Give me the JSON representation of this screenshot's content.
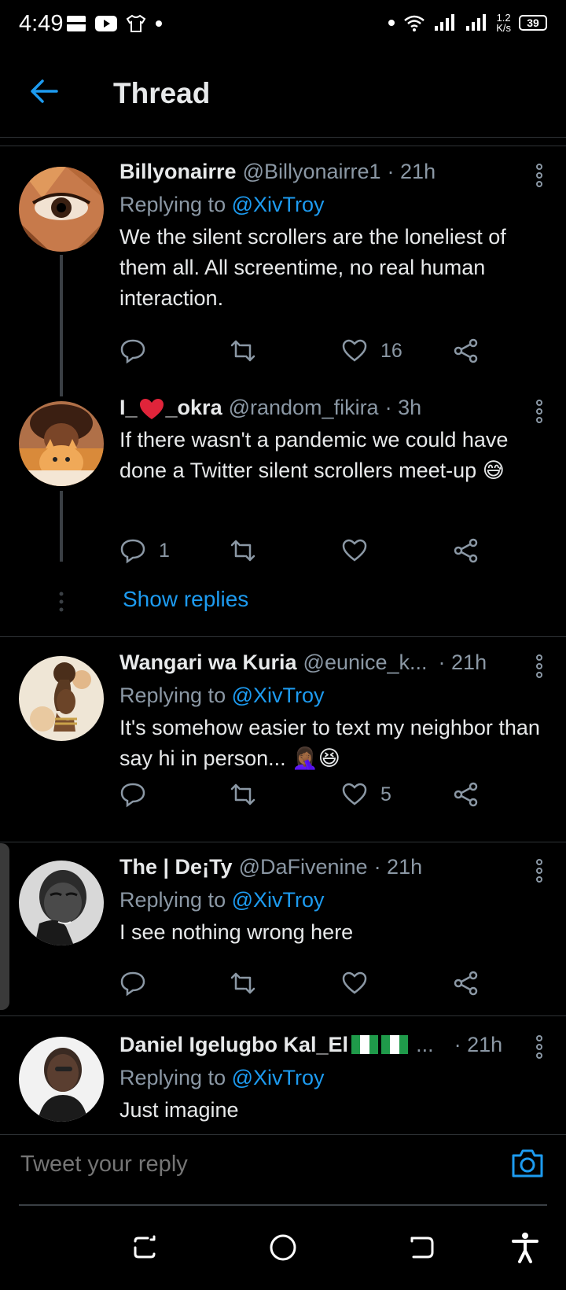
{
  "status_bar": {
    "time": "4:49",
    "net_speed_value": "1.2",
    "net_speed_unit": "K/s",
    "battery": "39"
  },
  "header": {
    "title": "Thread",
    "back_icon": "back-arrow-icon"
  },
  "tweets": [
    {
      "name": "Billyonairre",
      "handle": "@Billyonairre1",
      "time": "· 21h",
      "replying_label": "Replying to",
      "replying_to": "@XivTroy",
      "text": "We the silent scrollers are the loneliest of them all. All screentime, no real human interaction.",
      "replies": "",
      "retweets": "",
      "likes": "16"
    },
    {
      "name_prefix": "I_",
      "name_suffix": "_okra",
      "handle": "@random_fikira",
      "time": "· 3h",
      "text": "If there wasn't a pandemic we could have done a Twitter silent scrollers meet-up 😅",
      "replies": "1",
      "retweets": "",
      "likes": ""
    },
    {
      "name": "Wangari wa Kuria",
      "handle": "@eunice_k...",
      "time": "· 21h",
      "replying_label": "Replying to",
      "replying_to": "@XivTroy",
      "text": "It's somehow easier to text my neighbor than say hi in person... 🤦🏾‍♀️😆",
      "replies": "",
      "retweets": "",
      "likes": "5"
    },
    {
      "name": "The | De¡Ty",
      "handle": "@DaFivenine",
      "time": "· 21h",
      "replying_label": "Replying to",
      "replying_to": "@XivTroy",
      "text": "I see nothing wrong here",
      "replies": "",
      "retweets": "",
      "likes": ""
    },
    {
      "name": "Daniel Igelugbo Kal_El",
      "handle": "...",
      "time": "· 21h",
      "replying_label": "Replying to",
      "replying_to": "@XivTroy",
      "text": "Just imagine"
    }
  ],
  "show_replies": "Show replies",
  "composer": {
    "placeholder": "Tweet your reply"
  },
  "colors": {
    "accent": "#1d9bf0",
    "text": "#e7e9ea",
    "muted": "#8b98a5",
    "background": "#000000"
  }
}
